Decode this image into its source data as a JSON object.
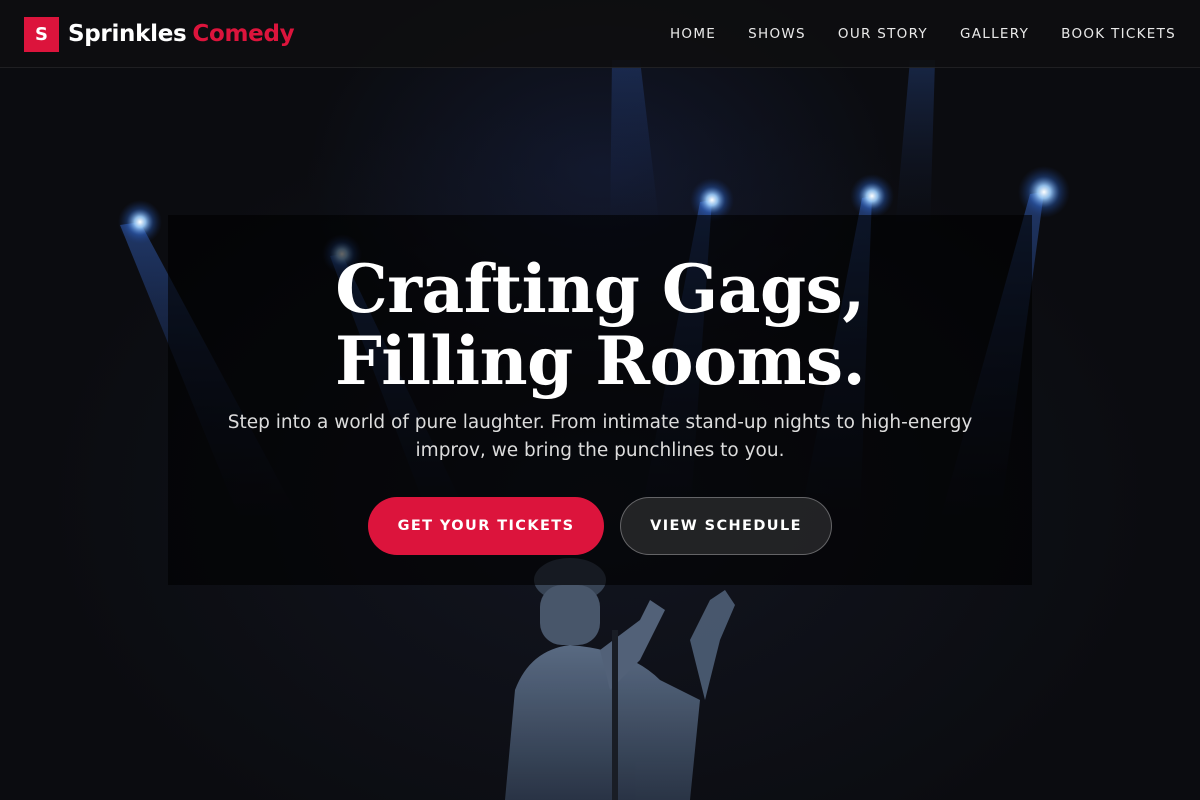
{
  "brand": {
    "logo_letter": "S",
    "name_first": "Sprinkles",
    "name_second": "Comedy",
    "accent_color": "#dc143c"
  },
  "nav": {
    "items": [
      {
        "label": "HOME"
      },
      {
        "label": "SHOWS"
      },
      {
        "label": "OUR STORY"
      },
      {
        "label": "GALLERY"
      },
      {
        "label": "BOOK TICKETS"
      }
    ]
  },
  "hero": {
    "title_line1": "Crafting Gags,",
    "title_line2": "Filling Rooms.",
    "subtitle": "Step into a world of pure laughter. From intimate stand-up nights to high-energy improv, we bring the punchlines to you.",
    "primary_cta": "GET YOUR TICKETS",
    "secondary_cta": "VIEW SCHEDULE",
    "background_image": "comedian-on-stage-with-microphone-under-blue-spotlights"
  }
}
